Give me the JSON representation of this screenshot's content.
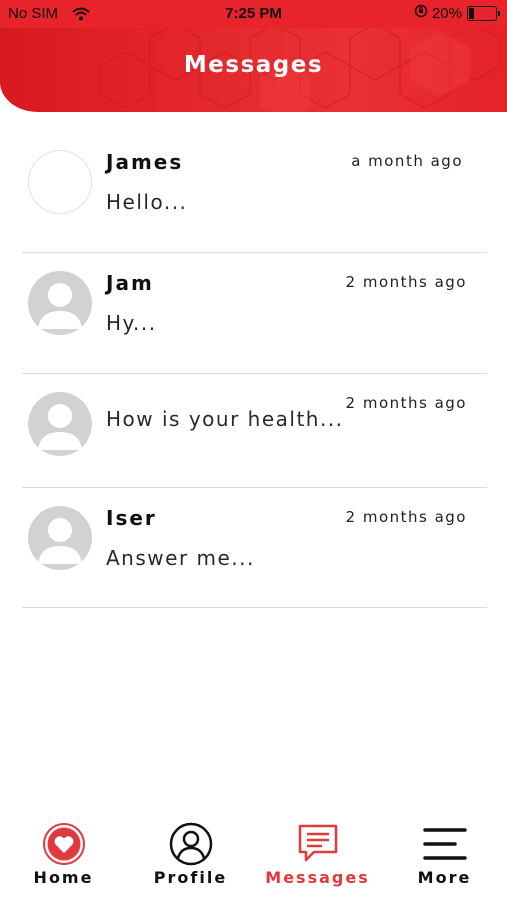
{
  "status_bar": {
    "carrier": "No SIM",
    "time": "7:25 PM",
    "battery": "20%",
    "battery_level": 0.2,
    "icons": [
      "wifi-icon",
      "orientation-lock-icon",
      "battery-icon"
    ]
  },
  "header": {
    "title": "Messages",
    "background_color": "#e8232b"
  },
  "conversations": [
    {
      "name": "James",
      "preview": "Hello...",
      "time": "a month ago",
      "avatar": "blank"
    },
    {
      "name": "Jam",
      "preview": "Hy...",
      "time": "2 months ago",
      "avatar": "person-placeholder-icon"
    },
    {
      "name": "",
      "preview": "How is your health...",
      "time": "2 months ago",
      "avatar": "person-placeholder-icon"
    },
    {
      "name": "Iser",
      "preview": "Answer me...",
      "time": "2 months ago",
      "avatar": "person-placeholder-icon"
    }
  ],
  "bottom_nav": {
    "active_color": "#e0393e",
    "items": [
      {
        "label": "Home",
        "icon": "heart-icon"
      },
      {
        "label": "Profile",
        "icon": "user-circle-icon"
      },
      {
        "label": "Messages",
        "icon": "chat-bubble-icon",
        "active": true
      },
      {
        "label": "More",
        "icon": "menu-icon"
      }
    ]
  }
}
